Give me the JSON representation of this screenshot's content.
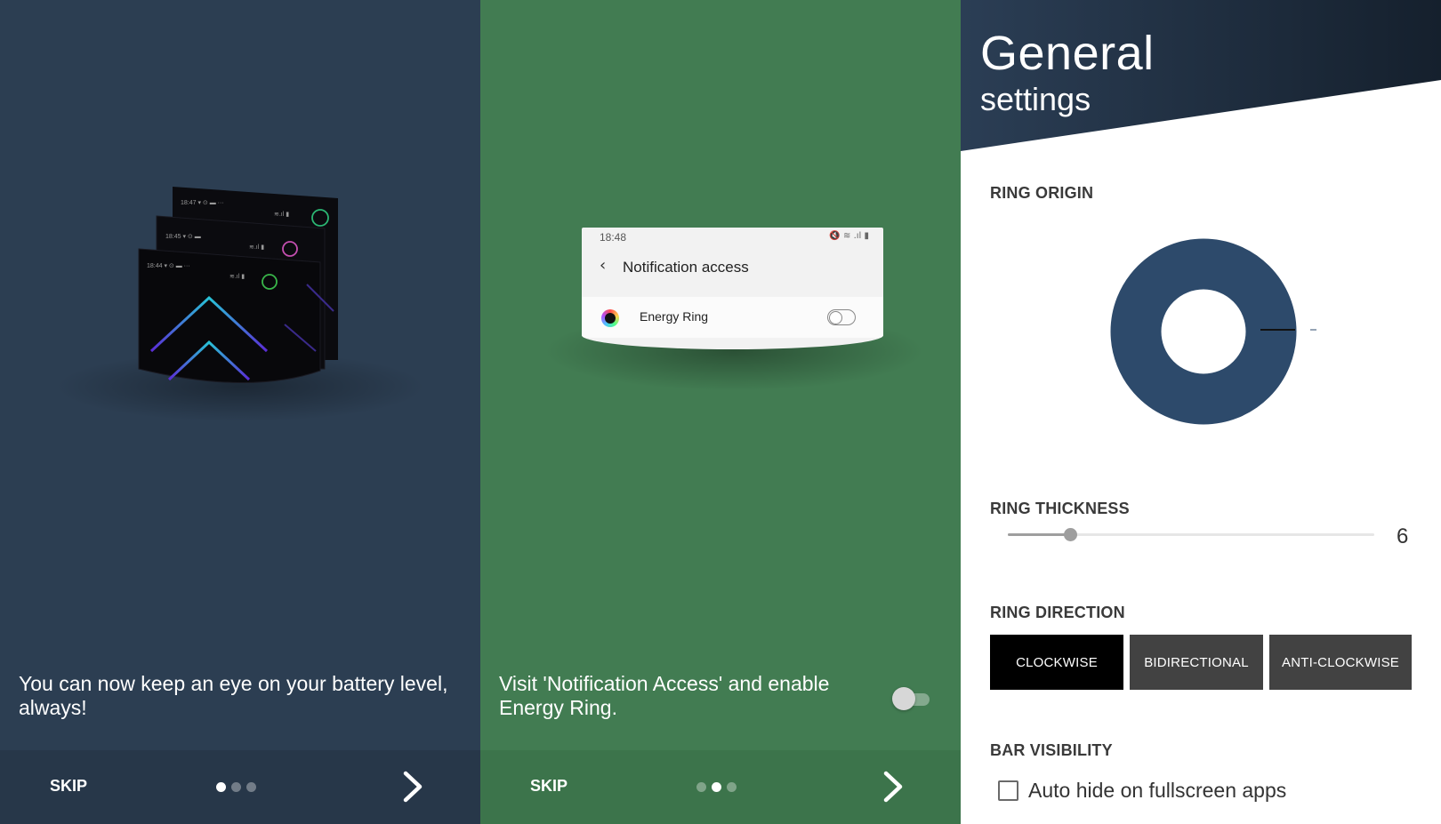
{
  "onboarding": [
    {
      "caption": "You can now keep an eye on your battery level, always!",
      "skip_label": "SKIP",
      "active_page": 1,
      "page_count": 3,
      "background": "#2c3e52",
      "phones": [
        {
          "time": "18:47",
          "ring_color": "#2bb673"
        },
        {
          "time": "18:45",
          "ring_color": "#c44fb0"
        },
        {
          "time": "18:44",
          "ring_color": "#39b54a"
        }
      ]
    },
    {
      "caption": "Visit 'Notification Access' and enable Energy Ring.",
      "skip_label": "SKIP",
      "active_page": 2,
      "page_count": 3,
      "background": "#427c52",
      "card": {
        "time": "18:48",
        "status_icons": "🔇 ≋ .ıl ▮",
        "title": "Notification access",
        "app_name": "Energy Ring"
      },
      "toggle_on": false
    }
  ],
  "settings": {
    "title": "General",
    "subtitle": "settings",
    "header_color": "#1f2d3d",
    "ring_origin": {
      "label": "RING ORIGIN",
      "ring_color": "#2d4a6b"
    },
    "ring_thickness": {
      "label": "RING THICKNESS",
      "value": "6",
      "fraction": 0.17
    },
    "ring_direction": {
      "label": "RING DIRECTION",
      "options": [
        "CLOCKWISE",
        "BIDIRECTIONAL",
        "ANTI-CLOCKWISE"
      ],
      "selected": "CLOCKWISE"
    },
    "bar_visibility": {
      "label": "BAR VISIBILITY",
      "checkbox_label": "Auto hide on fullscreen apps",
      "checked": false
    }
  }
}
